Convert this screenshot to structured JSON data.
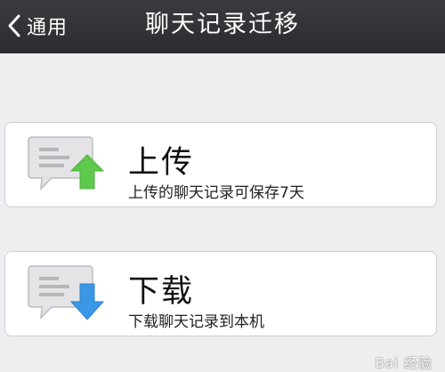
{
  "navbar": {
    "back_label": "通用",
    "title": "聊天记录迁移"
  },
  "cards": {
    "upload": {
      "title": "上传",
      "description": "上传的聊天记录可保存7天",
      "icon": "chat-upload-icon",
      "arrow_color": "#5ec94c"
    },
    "download": {
      "title": "下载",
      "description": "下载聊天记录到本机",
      "icon": "chat-download-icon",
      "arrow_color": "#3a97e6"
    }
  },
  "watermark": {
    "text": "Bai 经验"
  }
}
